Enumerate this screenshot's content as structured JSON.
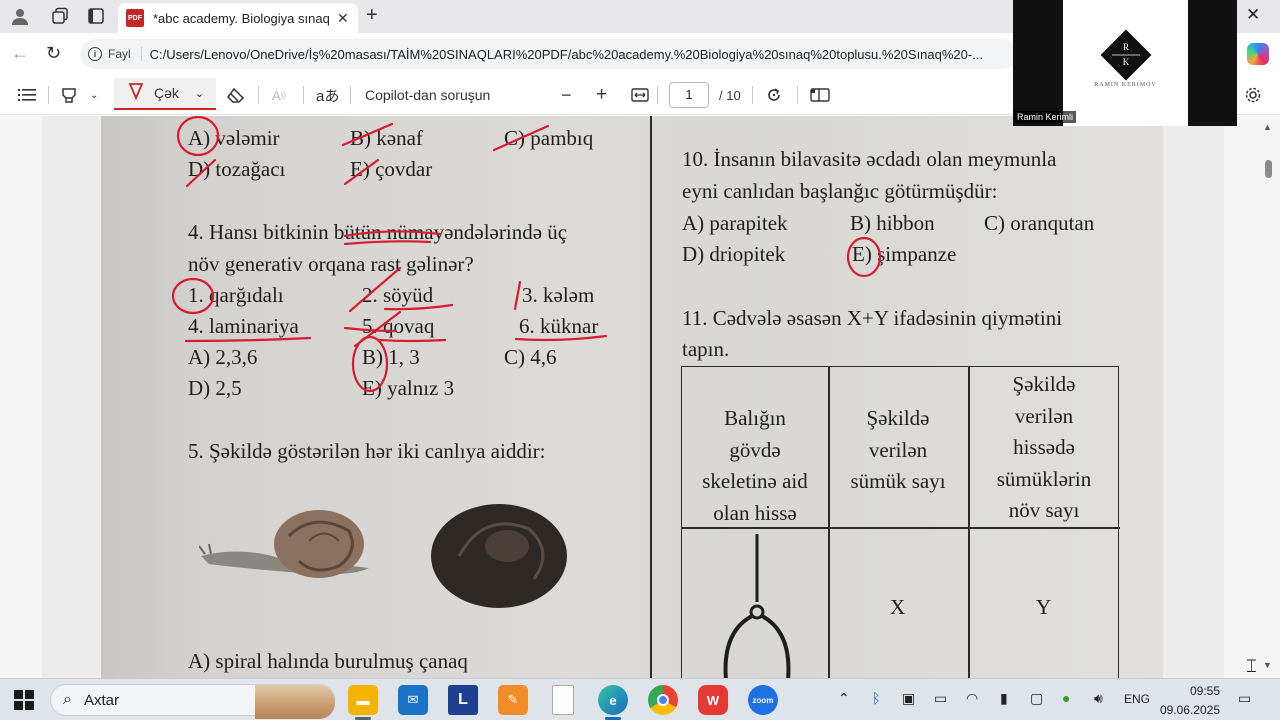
{
  "browser": {
    "tab_title": "*abc academy. Biologiya sınaq top",
    "tab_icon": "pdf-icon",
    "address_chip": "Fayl",
    "url": "C:/Users/Lenovo/OneDrive/İş%20masası/TAİM%20SINAQLARI%20PDF/abc%20academy.%20Biologiya%20sınaq%20toplusu.%20Sınaq%20-..."
  },
  "pdf_toolbar": {
    "draw_label": "Çək",
    "copilot_label": "Copilot-dan soruşun",
    "page_current": "1",
    "page_total": "/ 10",
    "draw_color": "#c62828"
  },
  "document": {
    "q3_options": [
      "A) vələmir",
      "B) kənaf",
      "C) pambıq",
      "D) tozağacı",
      "E) çovdar"
    ],
    "q4_stem_line1": "4.  Hansı bitkinin bütün nümayəndələrində üç",
    "q4_stem_line2": "növ generativ orqana rast gəlinər?",
    "q4_items": [
      "1. qarğıdalı",
      "2. söyüd",
      "3. kələm",
      "4. laminariya",
      "5. qovaq",
      "6. küknar"
    ],
    "q4_options": [
      "A) 2,3,6",
      "B) 1, 3",
      "C) 4,6",
      "D) 2,5",
      "E) yalnız 3"
    ],
    "q5_stem": "5. Şəkildə göstərilən hər iki canlıya aiddir:",
    "q5_option_a": "A) spiral halında burulmuş çanaq",
    "q10_stem_line1": "10. İnsanın bilavasitə əcdadı olan meymunla",
    "q10_stem_line2": "eyni canlıdan başlanğıc götürmüşdür:",
    "q10_options": [
      "A) parapitek",
      "B) hibbon",
      "C) oranqutan",
      "D) driopitek",
      "E) şimpanze"
    ],
    "q11_stem_line1": "11. Cədvələ əsasən X+Y ifadəsinin qiymətini",
    "q11_stem_line2": "tapın.",
    "table_headers": [
      "Balığın\ngövdə\nskeletinə aid\nolan hissə",
      "Şəkildə\nverilən\nsümük sayı",
      "Şəkildə\nverilən\nhissədə\nsümüklərin\nnöv sayı"
    ],
    "table_values": [
      "X",
      "Y"
    ]
  },
  "webcam": {
    "name_label": "Ramin Kerimli",
    "logo_letters": [
      "R",
      "K"
    ],
    "logo_caption": "RAMIN KERIMOV"
  },
  "taskbar": {
    "search_label": "Axtar",
    "language": "ENG",
    "time": "09:55",
    "date": "09.06.2025"
  }
}
